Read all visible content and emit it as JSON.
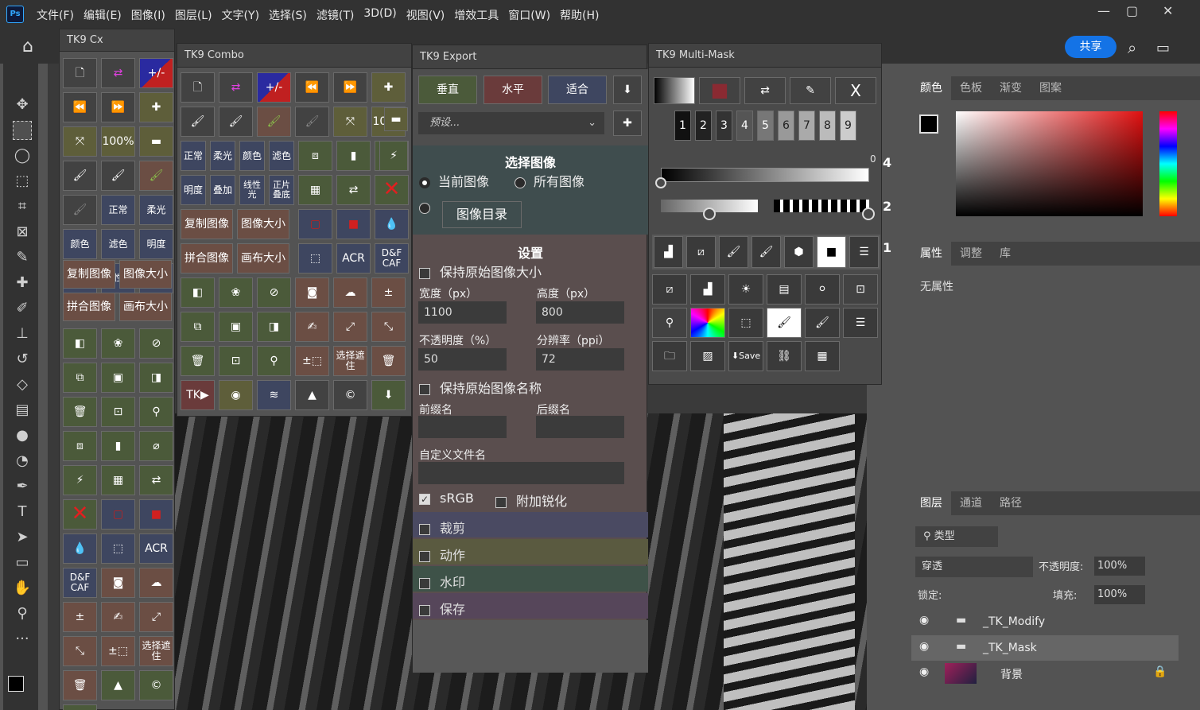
{
  "menu": [
    "文件(F)",
    "编辑(E)",
    "图像(I)",
    "图层(L)",
    "文字(Y)",
    "选择(S)",
    "滤镜(T)",
    "3D(D)",
    "视图(V)",
    "增效工具",
    "窗口(W)",
    "帮助(H)"
  ],
  "logo": "Ps",
  "window_controls": [
    "minimize-icon",
    "maximize-icon",
    "close-icon"
  ],
  "share": "共享",
  "tools": [
    "move-icon",
    "marquee-icon",
    "lasso-icon",
    "object-select-icon",
    "crop-icon",
    "frame-icon",
    "eyedropper-icon",
    "healing-icon",
    "brush-icon",
    "stamp-icon",
    "history-brush-icon",
    "eraser-icon",
    "gradient-icon",
    "blur-icon",
    "dodge-icon",
    "pen-icon",
    "type-icon",
    "path-select-icon",
    "rectangle-icon",
    "hand-icon",
    "zoom-icon",
    "more-icon"
  ],
  "tk9cx": {
    "title": "TK9 Cx",
    "labels": {
      "zoom": "100%",
      "normal": "正常",
      "soft": "柔光",
      "color": "颜色",
      "filter": "滤色",
      "lum": "明度",
      "overlay": "叠加",
      "linear": "线性光",
      "multiply": "正片叠底",
      "dup": "复制图像",
      "imgsize": "图像大小",
      "merge": "拼合图像",
      "canvas": "画布大小",
      "acr": "ACR",
      "dfcaf": "D&F CAF",
      "selmask": "选择遮住"
    }
  },
  "tk9combo": {
    "title": "TK9 Combo"
  },
  "export": {
    "title": "TK9 Export",
    "btn_v": "垂直",
    "btn_h": "水平",
    "btn_fit": "适合",
    "preset": "预设...",
    "select_title": "选择图像",
    "cur": "当前图像",
    "all": "所有图像",
    "dir": "图像目录",
    "settings": "设置",
    "keep_size": "保持原始图像大小",
    "w_label": "宽度（px）",
    "h_label": "高度（px）",
    "w": "1100",
    "h": "800",
    "op_label": "不透明度（%）",
    "res_label": "分辨率（ppi）",
    "op": "50",
    "res": "72",
    "keep_name": "保持原始图像名称",
    "prefix": "前缀名",
    "suffix": "后缀名",
    "custom": "自定义文件名",
    "srgb": "sRGB",
    "sharpen": "附加锐化",
    "crop": "裁剪",
    "action": "动作",
    "watermark": "水印",
    "save": "保存"
  },
  "multimask": {
    "title": "TK9 Multi-Mask",
    "nums": [
      "1",
      "2",
      "3",
      "4",
      "5",
      "6",
      "7",
      "8",
      "9"
    ],
    "x": "X",
    "zero": "0"
  },
  "color_tabs": [
    "颜色",
    "色板",
    "渐变",
    "图案"
  ],
  "props_tabs": [
    "属性",
    "调整",
    "库"
  ],
  "props_text": "无属性",
  "layers_tabs": [
    "图层",
    "通道",
    "路径"
  ],
  "layers": {
    "kind": "类型",
    "blend": "穿透",
    "opacity_label": "不透明度:",
    "opacity": "100%",
    "lock_label": "锁定:",
    "fill_label": "填充:",
    "fill": "100%",
    "items": [
      "_TK_Modify",
      "_TK_Mask",
      "背景"
    ]
  },
  "side_nums": [
    "4",
    "2",
    "1"
  ]
}
